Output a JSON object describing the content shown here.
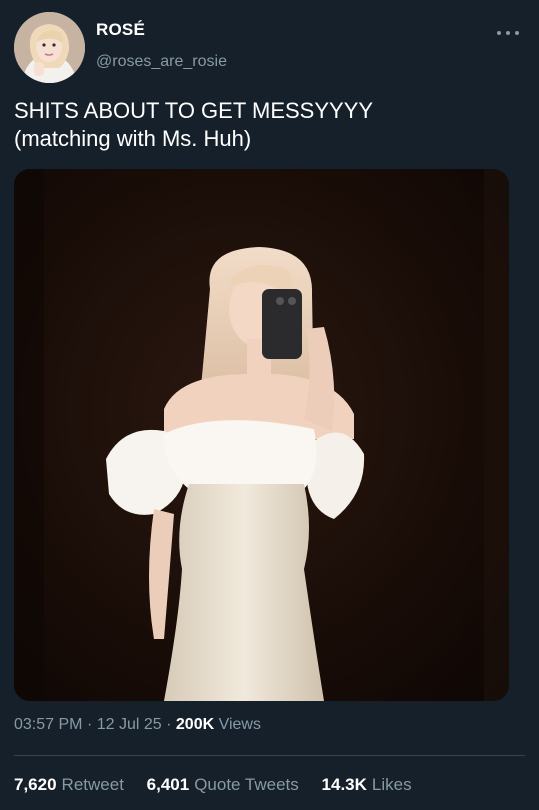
{
  "user": {
    "display_name": "ROSÉ",
    "handle": "@roses_are_rosie",
    "avatar_icon": "profile-photo"
  },
  "tweet": {
    "text": "SHITS ABOUT TO GET MESSYYYY\n(matching with Ms. Huh)"
  },
  "meta": {
    "time": "03:57 PM",
    "sep1": "·",
    "date": "12 Jul 25",
    "sep2": "·",
    "views_count": "200K",
    "views_label": "Views"
  },
  "stats": {
    "retweets_count": "7,620",
    "retweets_label": "Retweet",
    "quotes_count": "6,401",
    "quotes_label": "Quote Tweets",
    "likes_count": "14.3K",
    "likes_label": "Likes"
  },
  "colors": {
    "background": "#15202b",
    "text_primary": "#ffffff",
    "text_secondary": "#8899a6",
    "divider": "#38444d"
  }
}
